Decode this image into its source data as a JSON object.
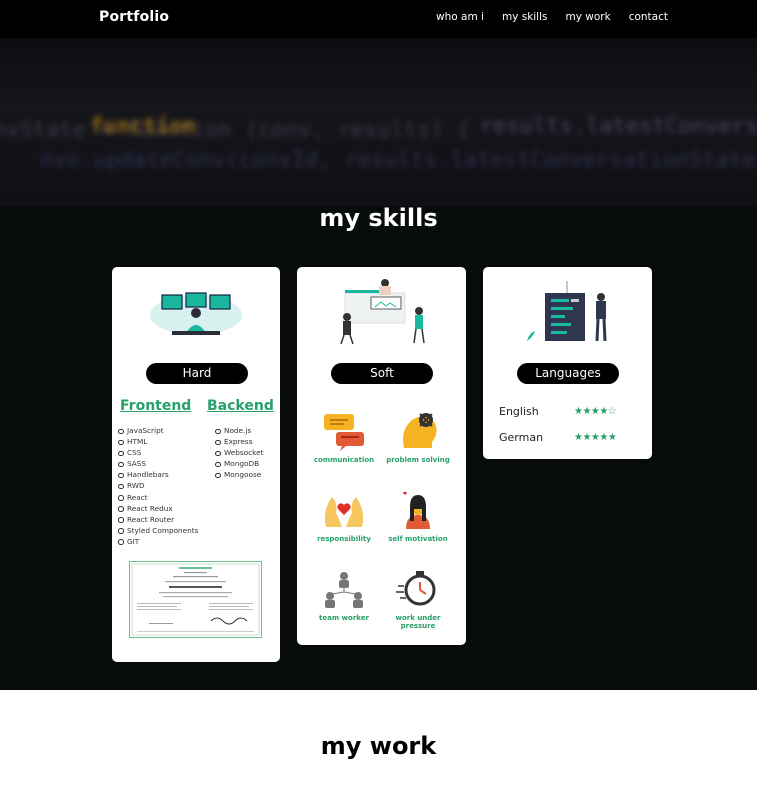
{
  "navbar": {
    "brand": "Portfolio",
    "links": [
      "who am i",
      "my skills",
      "my work",
      "contact"
    ]
  },
  "skills": {
    "title": "my skills",
    "cards": {
      "hard": {
        "pill": "Hard",
        "frontend_title": "Frontend",
        "backend_title": "Backend",
        "frontend_items": [
          "JavaScript",
          "HTML",
          "CSS",
          "SASS",
          "Handlebars",
          "RWD",
          "React",
          "React Redux",
          "React Router",
          "Styled Components",
          "GIT"
        ],
        "backend_items": [
          "Node.js",
          "Express",
          "Websocket",
          "MongoDB",
          "Mongoose"
        ]
      },
      "soft": {
        "pill": "Soft",
        "items": [
          "communication",
          "problem solving",
          "responsibility",
          "self motivation",
          "team worker",
          "work under pressure"
        ]
      },
      "languages": {
        "pill": "Languages",
        "items": [
          {
            "name": "English",
            "stars": "★★★★☆",
            "rating": 4.5
          },
          {
            "name": "German",
            "stars": "★★★★★",
            "rating": 4.5
          }
        ]
      }
    }
  },
  "work": {
    "title": "my work"
  },
  "colors": {
    "accent": "#27a06b",
    "dark": "#080b0c"
  }
}
